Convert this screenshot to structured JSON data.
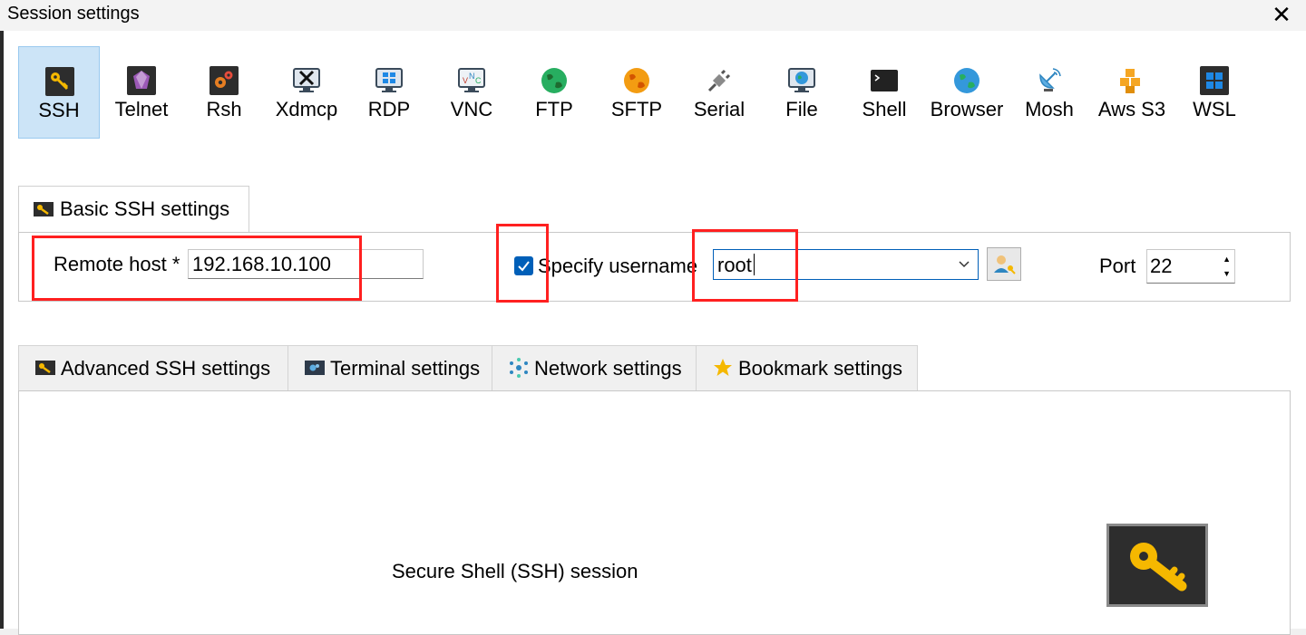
{
  "window": {
    "title": "Session settings",
    "close_glyph": "✕"
  },
  "protocols": [
    {
      "label": "SSH",
      "icon": "key-icon"
    },
    {
      "label": "Telnet",
      "icon": "purple-gem-icon"
    },
    {
      "label": "Rsh",
      "icon": "gears-icon"
    },
    {
      "label": "Xdmcp",
      "icon": "x-monitor-icon"
    },
    {
      "label": "RDP",
      "icon": "windows-monitor-icon"
    },
    {
      "label": "VNC",
      "icon": "vnc-monitor-icon"
    },
    {
      "label": "FTP",
      "icon": "green-globe-icon"
    },
    {
      "label": "SFTP",
      "icon": "orange-globe-icon"
    },
    {
      "label": "Serial",
      "icon": "plug-icon"
    },
    {
      "label": "File",
      "icon": "globe-monitor-icon"
    },
    {
      "label": "Shell",
      "icon": "terminal-icon"
    },
    {
      "label": "Browser",
      "icon": "blue-globe-icon"
    },
    {
      "label": "Mosh",
      "icon": "satellite-dish-icon"
    },
    {
      "label": "Aws S3",
      "icon": "cubes-icon"
    },
    {
      "label": "WSL",
      "icon": "windows-logo-icon"
    }
  ],
  "basic_tab": {
    "label": "Basic SSH settings"
  },
  "basic": {
    "remote_host_label": "Remote host *",
    "remote_host_value": "192.168.10.100",
    "specify_username_label": "Specify username",
    "specify_username_checked": true,
    "username_value": "root",
    "port_label": "Port",
    "port_value": "22"
  },
  "tabs": [
    {
      "label": "Advanced SSH settings",
      "icon": "key-icon"
    },
    {
      "label": "Terminal settings",
      "icon": "terminal-icon"
    },
    {
      "label": "Network settings",
      "icon": "network-icon"
    },
    {
      "label": "Bookmark settings",
      "icon": "star-icon"
    }
  ],
  "main": {
    "description": "Secure Shell (SSH) session"
  },
  "colors": {
    "accent": "#005fb8",
    "selected_bg": "#cce4f7",
    "highlight": "#ff2020"
  }
}
